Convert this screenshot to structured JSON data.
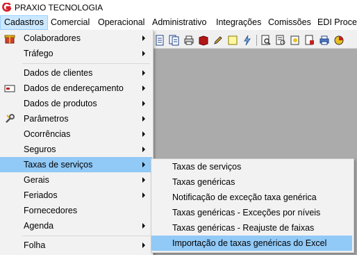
{
  "app": {
    "title": "PRAXIO TECNOLOGIA"
  },
  "colors": {
    "logo_red": "#d4202a",
    "highlight": "#91c9f7",
    "menu_bg": "#f2f2f2",
    "active_menubar": "#cce8ff"
  },
  "menubar": [
    {
      "label": "Cadastros"
    },
    {
      "label": "Comercial"
    },
    {
      "label": "Operacional"
    },
    {
      "label": "Administrativo"
    },
    {
      "label": "Integrações"
    },
    {
      "label": "Comissões"
    },
    {
      "label": "EDI Proced"
    }
  ],
  "cadastros_menu": {
    "items": [
      {
        "label": "Colaboradores",
        "icon": "gift-box-icon",
        "submenu": true
      },
      {
        "label": "Tráfego",
        "submenu": true
      },
      {
        "label": "Dados de clientes",
        "submenu": true
      },
      {
        "label": "Dados de endereçamento",
        "icon": "envelope-icon",
        "submenu": true
      },
      {
        "label": "Dados de produtos",
        "submenu": true
      },
      {
        "label": "Parâmetros",
        "icon": "wrench-icon",
        "submenu": true
      },
      {
        "label": "Ocorrências",
        "submenu": true
      },
      {
        "label": "Seguros",
        "submenu": true
      },
      {
        "label": "Taxas de serviços",
        "submenu": true,
        "selected": true
      },
      {
        "label": "Gerais",
        "submenu": true
      },
      {
        "label": "Feriados",
        "submenu": true
      },
      {
        "label": "Fornecedores",
        "submenu": false
      },
      {
        "label": "Agenda",
        "submenu": true
      },
      {
        "label": "Folha",
        "submenu": true
      }
    ]
  },
  "taxas_submenu": {
    "items": [
      {
        "label": "Taxas de serviços"
      },
      {
        "label": "Taxas genéricas"
      },
      {
        "label": "Notificação de exceção taxa genérica"
      },
      {
        "label": "Taxas genéricas - Exceções por níveis"
      },
      {
        "label": "Taxas genéricas - Reajuste de faixas"
      },
      {
        "label": "Importação de taxas genéricas do Excel",
        "selected": true
      }
    ]
  },
  "toolbar": {
    "icons": [
      "document-icon",
      "documents-icon",
      "printer-icon",
      "book-icon",
      "pencil-icon",
      "note-icon",
      "lightning-icon",
      "search-document-icon",
      "report-icon",
      "star-document-icon",
      "report-edit-icon",
      "print-icon",
      "pie-chart-icon"
    ]
  }
}
